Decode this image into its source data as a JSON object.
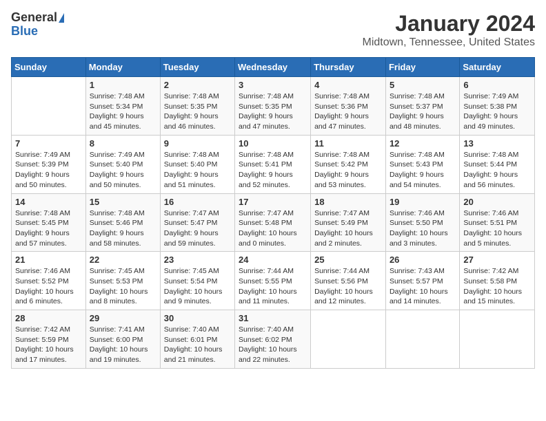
{
  "logo": {
    "general": "General",
    "blue": "Blue"
  },
  "title": "January 2024",
  "subtitle": "Midtown, Tennessee, United States",
  "days_of_week": [
    "Sunday",
    "Monday",
    "Tuesday",
    "Wednesday",
    "Thursday",
    "Friday",
    "Saturday"
  ],
  "weeks": [
    [
      {
        "day": "",
        "sunrise": "",
        "sunset": "",
        "daylight": ""
      },
      {
        "day": "1",
        "sunrise": "Sunrise: 7:48 AM",
        "sunset": "Sunset: 5:34 PM",
        "daylight": "Daylight: 9 hours and 45 minutes."
      },
      {
        "day": "2",
        "sunrise": "Sunrise: 7:48 AM",
        "sunset": "Sunset: 5:35 PM",
        "daylight": "Daylight: 9 hours and 46 minutes."
      },
      {
        "day": "3",
        "sunrise": "Sunrise: 7:48 AM",
        "sunset": "Sunset: 5:35 PM",
        "daylight": "Daylight: 9 hours and 47 minutes."
      },
      {
        "day": "4",
        "sunrise": "Sunrise: 7:48 AM",
        "sunset": "Sunset: 5:36 PM",
        "daylight": "Daylight: 9 hours and 47 minutes."
      },
      {
        "day": "5",
        "sunrise": "Sunrise: 7:48 AM",
        "sunset": "Sunset: 5:37 PM",
        "daylight": "Daylight: 9 hours and 48 minutes."
      },
      {
        "day": "6",
        "sunrise": "Sunrise: 7:49 AM",
        "sunset": "Sunset: 5:38 PM",
        "daylight": "Daylight: 9 hours and 49 minutes."
      }
    ],
    [
      {
        "day": "7",
        "sunrise": "Sunrise: 7:49 AM",
        "sunset": "Sunset: 5:39 PM",
        "daylight": "Daylight: 9 hours and 50 minutes."
      },
      {
        "day": "8",
        "sunrise": "Sunrise: 7:49 AM",
        "sunset": "Sunset: 5:40 PM",
        "daylight": "Daylight: 9 hours and 50 minutes."
      },
      {
        "day": "9",
        "sunrise": "Sunrise: 7:48 AM",
        "sunset": "Sunset: 5:40 PM",
        "daylight": "Daylight: 9 hours and 51 minutes."
      },
      {
        "day": "10",
        "sunrise": "Sunrise: 7:48 AM",
        "sunset": "Sunset: 5:41 PM",
        "daylight": "Daylight: 9 hours and 52 minutes."
      },
      {
        "day": "11",
        "sunrise": "Sunrise: 7:48 AM",
        "sunset": "Sunset: 5:42 PM",
        "daylight": "Daylight: 9 hours and 53 minutes."
      },
      {
        "day": "12",
        "sunrise": "Sunrise: 7:48 AM",
        "sunset": "Sunset: 5:43 PM",
        "daylight": "Daylight: 9 hours and 54 minutes."
      },
      {
        "day": "13",
        "sunrise": "Sunrise: 7:48 AM",
        "sunset": "Sunset: 5:44 PM",
        "daylight": "Daylight: 9 hours and 56 minutes."
      }
    ],
    [
      {
        "day": "14",
        "sunrise": "Sunrise: 7:48 AM",
        "sunset": "Sunset: 5:45 PM",
        "daylight": "Daylight: 9 hours and 57 minutes."
      },
      {
        "day": "15",
        "sunrise": "Sunrise: 7:48 AM",
        "sunset": "Sunset: 5:46 PM",
        "daylight": "Daylight: 9 hours and 58 minutes."
      },
      {
        "day": "16",
        "sunrise": "Sunrise: 7:47 AM",
        "sunset": "Sunset: 5:47 PM",
        "daylight": "Daylight: 9 hours and 59 minutes."
      },
      {
        "day": "17",
        "sunrise": "Sunrise: 7:47 AM",
        "sunset": "Sunset: 5:48 PM",
        "daylight": "Daylight: 10 hours and 0 minutes."
      },
      {
        "day": "18",
        "sunrise": "Sunrise: 7:47 AM",
        "sunset": "Sunset: 5:49 PM",
        "daylight": "Daylight: 10 hours and 2 minutes."
      },
      {
        "day": "19",
        "sunrise": "Sunrise: 7:46 AM",
        "sunset": "Sunset: 5:50 PM",
        "daylight": "Daylight: 10 hours and 3 minutes."
      },
      {
        "day": "20",
        "sunrise": "Sunrise: 7:46 AM",
        "sunset": "Sunset: 5:51 PM",
        "daylight": "Daylight: 10 hours and 5 minutes."
      }
    ],
    [
      {
        "day": "21",
        "sunrise": "Sunrise: 7:46 AM",
        "sunset": "Sunset: 5:52 PM",
        "daylight": "Daylight: 10 hours and 6 minutes."
      },
      {
        "day": "22",
        "sunrise": "Sunrise: 7:45 AM",
        "sunset": "Sunset: 5:53 PM",
        "daylight": "Daylight: 10 hours and 8 minutes."
      },
      {
        "day": "23",
        "sunrise": "Sunrise: 7:45 AM",
        "sunset": "Sunset: 5:54 PM",
        "daylight": "Daylight: 10 hours and 9 minutes."
      },
      {
        "day": "24",
        "sunrise": "Sunrise: 7:44 AM",
        "sunset": "Sunset: 5:55 PM",
        "daylight": "Daylight: 10 hours and 11 minutes."
      },
      {
        "day": "25",
        "sunrise": "Sunrise: 7:44 AM",
        "sunset": "Sunset: 5:56 PM",
        "daylight": "Daylight: 10 hours and 12 minutes."
      },
      {
        "day": "26",
        "sunrise": "Sunrise: 7:43 AM",
        "sunset": "Sunset: 5:57 PM",
        "daylight": "Daylight: 10 hours and 14 minutes."
      },
      {
        "day": "27",
        "sunrise": "Sunrise: 7:42 AM",
        "sunset": "Sunset: 5:58 PM",
        "daylight": "Daylight: 10 hours and 15 minutes."
      }
    ],
    [
      {
        "day": "28",
        "sunrise": "Sunrise: 7:42 AM",
        "sunset": "Sunset: 5:59 PM",
        "daylight": "Daylight: 10 hours and 17 minutes."
      },
      {
        "day": "29",
        "sunrise": "Sunrise: 7:41 AM",
        "sunset": "Sunset: 6:00 PM",
        "daylight": "Daylight: 10 hours and 19 minutes."
      },
      {
        "day": "30",
        "sunrise": "Sunrise: 7:40 AM",
        "sunset": "Sunset: 6:01 PM",
        "daylight": "Daylight: 10 hours and 21 minutes."
      },
      {
        "day": "31",
        "sunrise": "Sunrise: 7:40 AM",
        "sunset": "Sunset: 6:02 PM",
        "daylight": "Daylight: 10 hours and 22 minutes."
      },
      {
        "day": "",
        "sunrise": "",
        "sunset": "",
        "daylight": ""
      },
      {
        "day": "",
        "sunrise": "",
        "sunset": "",
        "daylight": ""
      },
      {
        "day": "",
        "sunrise": "",
        "sunset": "",
        "daylight": ""
      }
    ]
  ]
}
